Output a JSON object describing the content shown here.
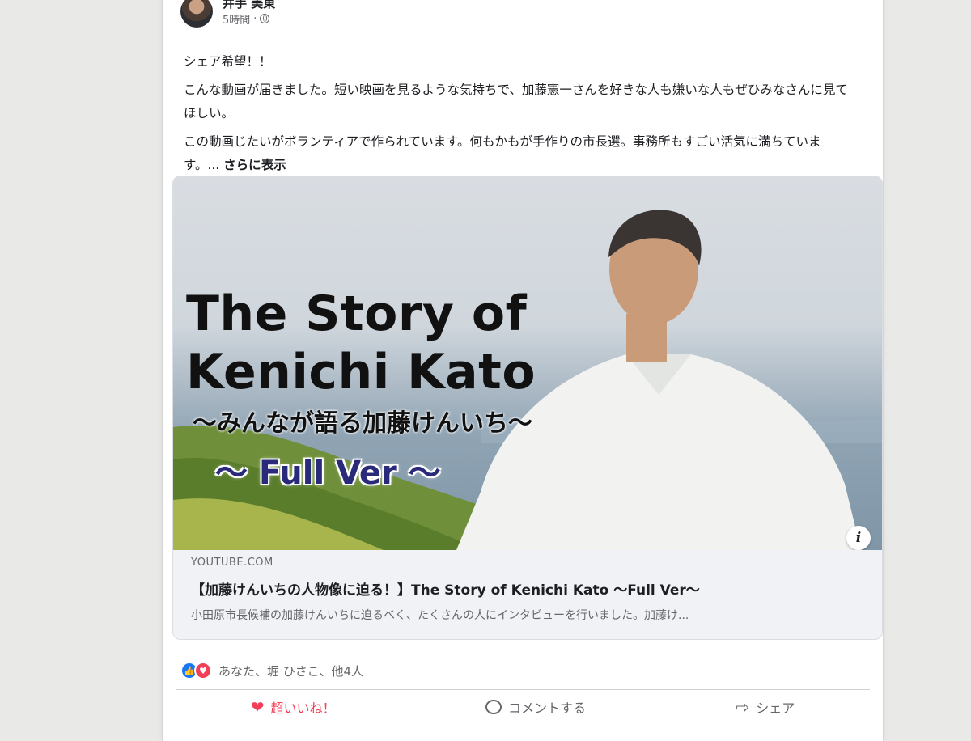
{
  "post": {
    "author": "井手 美東",
    "time": "5時間",
    "paragraphs": [
      "シェア希望！！",
      "こんな動画が届きました。短い映画を見るような気持ちで、加藤憲一さんを好きな人も嫌いな人もぜひみなさんに見てほしい。",
      "この動画じたいがボランティアで作られています。何もかもが手作りの市長選。事務所もすごい活気に満ちています。..."
    ],
    "see_more": "さらに表示"
  },
  "link": {
    "thumbnail": {
      "title_line1": "The Story of",
      "title_line2": "Kenichi Kato",
      "subtitle": "～みんなが語る加藤けんいち～",
      "full": "～ Full Ver ～",
      "info": "i"
    },
    "domain": "YOUTUBE.COM",
    "title": "【加藤けんいちの人物像に迫る！】The Story of Kenichi Kato ～Full Ver～",
    "description": "小田原市長候補の加藤けんいちに迫るべく、たくさんの人にインタビューを行いました。加藤け..."
  },
  "reactions": {
    "text": "あなた、堀 ひさこ、他4人"
  },
  "actions": {
    "like": "超いいね！",
    "comment": "コメントする",
    "share": "シェア"
  },
  "colors": {
    "like_blue": "#1877f2",
    "love_red": "#f33e58",
    "secondary_text": "#65676b"
  }
}
